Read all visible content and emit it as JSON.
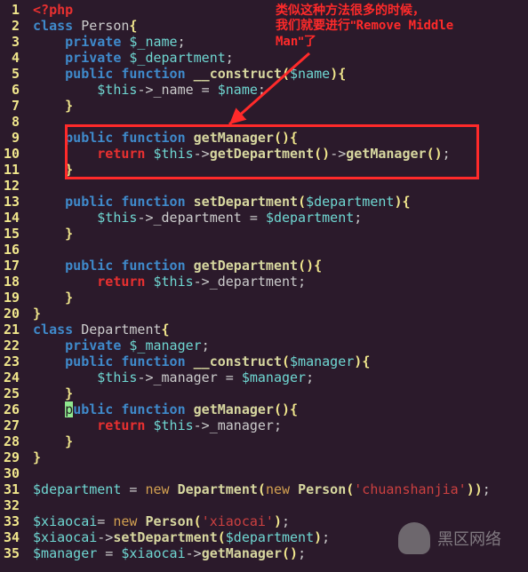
{
  "annotation": {
    "line1": "类似这种方法很多的时候，",
    "line2_pre": "我们就要进行\"",
    "line2_en": "Remove Middle",
    "line3_en": "Man",
    "line3_post": "\"了"
  },
  "watermark": "黑区网络",
  "keywords": {
    "php_open": "<?php",
    "class": "class",
    "private": "private",
    "public": "public",
    "function": "function",
    "return": "return",
    "new": "new"
  },
  "classes": {
    "person": "Person",
    "department": "Department"
  },
  "vars": {
    "name_prop": "$_name",
    "department_prop": "$_department",
    "manager_prop": "$_manager",
    "name": "$name",
    "department": "$department",
    "manager": "$manager",
    "this": "$this",
    "xiaocai": "$xiaocai"
  },
  "methods": {
    "construct": "__construct",
    "getManager": "getManager",
    "setDepartment": "setDepartment",
    "getDepartment": "getDepartment"
  },
  "members": {
    "name": "_name",
    "department": "_department",
    "manager": "_manager"
  },
  "strings": {
    "chuanshanjia": "'chuanshanjia'",
    "xiaocai": "'xiaocai'"
  },
  "punct": {
    "brace_open": "{",
    "brace_close": "}",
    "paren_open": "(",
    "paren_close": ")",
    "semi": ";",
    "arrow": "->",
    "assign": " = ",
    "eq": "="
  },
  "lines": [
    "1",
    "2",
    "3",
    "4",
    "5",
    "6",
    "7",
    "8",
    "9",
    "10",
    "11",
    "12",
    "13",
    "14",
    "15",
    "16",
    "17",
    "18",
    "19",
    "20",
    "21",
    "22",
    "23",
    "24",
    "25",
    "26",
    "27",
    "28",
    "29",
    "30",
    "31",
    "32",
    "33",
    "34",
    "35"
  ]
}
